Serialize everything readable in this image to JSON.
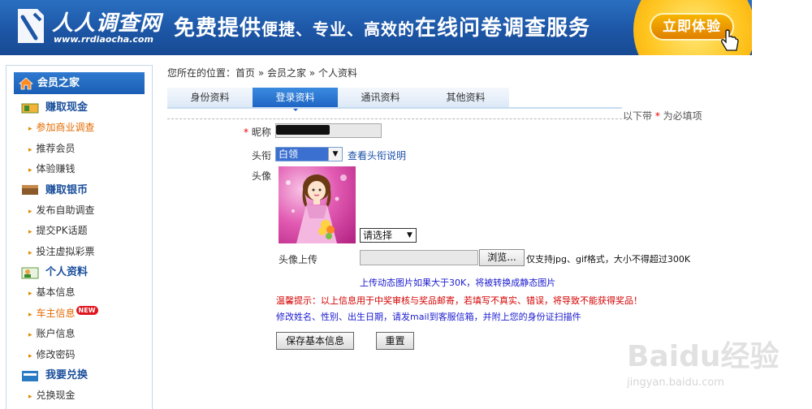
{
  "banner": {
    "logo_text": "人人调查网",
    "logo_url": "www.rrdiaocha.com",
    "slogan_a": "免费提供",
    "slogan_b": "便捷、专业、高效的",
    "slogan_c": "在线问卷调查服务",
    "try_button": "立即体验",
    "brand_color": "#1d56a6",
    "accent_color": "#ffc520"
  },
  "sidebar": {
    "header": "会员之家",
    "sections": [
      {
        "title": "赚取现金",
        "items": [
          "参加商业调查",
          "推荐会员",
          "体验赚钱"
        ]
      },
      {
        "title": "赚取银币",
        "items": [
          "发布自助调查",
          "提交PK话题",
          "投注虚拟彩票"
        ]
      },
      {
        "title": "个人资料",
        "items": [
          "基本信息",
          "车主信息",
          "账户信息",
          "修改密码"
        ]
      },
      {
        "title": "我要兑换",
        "items": [
          "兑换现金"
        ]
      }
    ],
    "new_badge": "NEW"
  },
  "main": {
    "breadcrumb": "您所在的位置：首页 » 会员之家 » 个人资料",
    "tabs": [
      "身份资料",
      "登录资料",
      "通讯资料",
      "其他资料"
    ],
    "active_tab": "登录资料",
    "required_hint_before": "以下带 ",
    "required_star": "*",
    "required_hint_after": " 为必填项",
    "form": {
      "nickname_label": "昵称",
      "title_label": "头衔",
      "title_value": "白领",
      "title_link": "查看头衔说明",
      "avatar_label": "头像",
      "avatar_select": "请选择",
      "upload_label": "头像上传",
      "browse_button": "浏览...",
      "upload_note": "仅支持jpg、gif格式，大小不得超过300K"
    },
    "tip_blue": "上传动态图片如果大于30K，将被转换成静态图片",
    "tip_red": "温馨提示：以上信息用于中奖审核与奖品邮寄，若填写不真实、错误，将导致不能获得奖品！",
    "tip_blue2": "修改姓名、性别、出生日期，请发mail到客服信箱，并附上您的身份证扫描件",
    "save_button": "保存基本信息",
    "reset_button": "重置"
  },
  "watermark": {
    "brand": "Baidu经验",
    "url": "jingyan.baidu.com"
  }
}
